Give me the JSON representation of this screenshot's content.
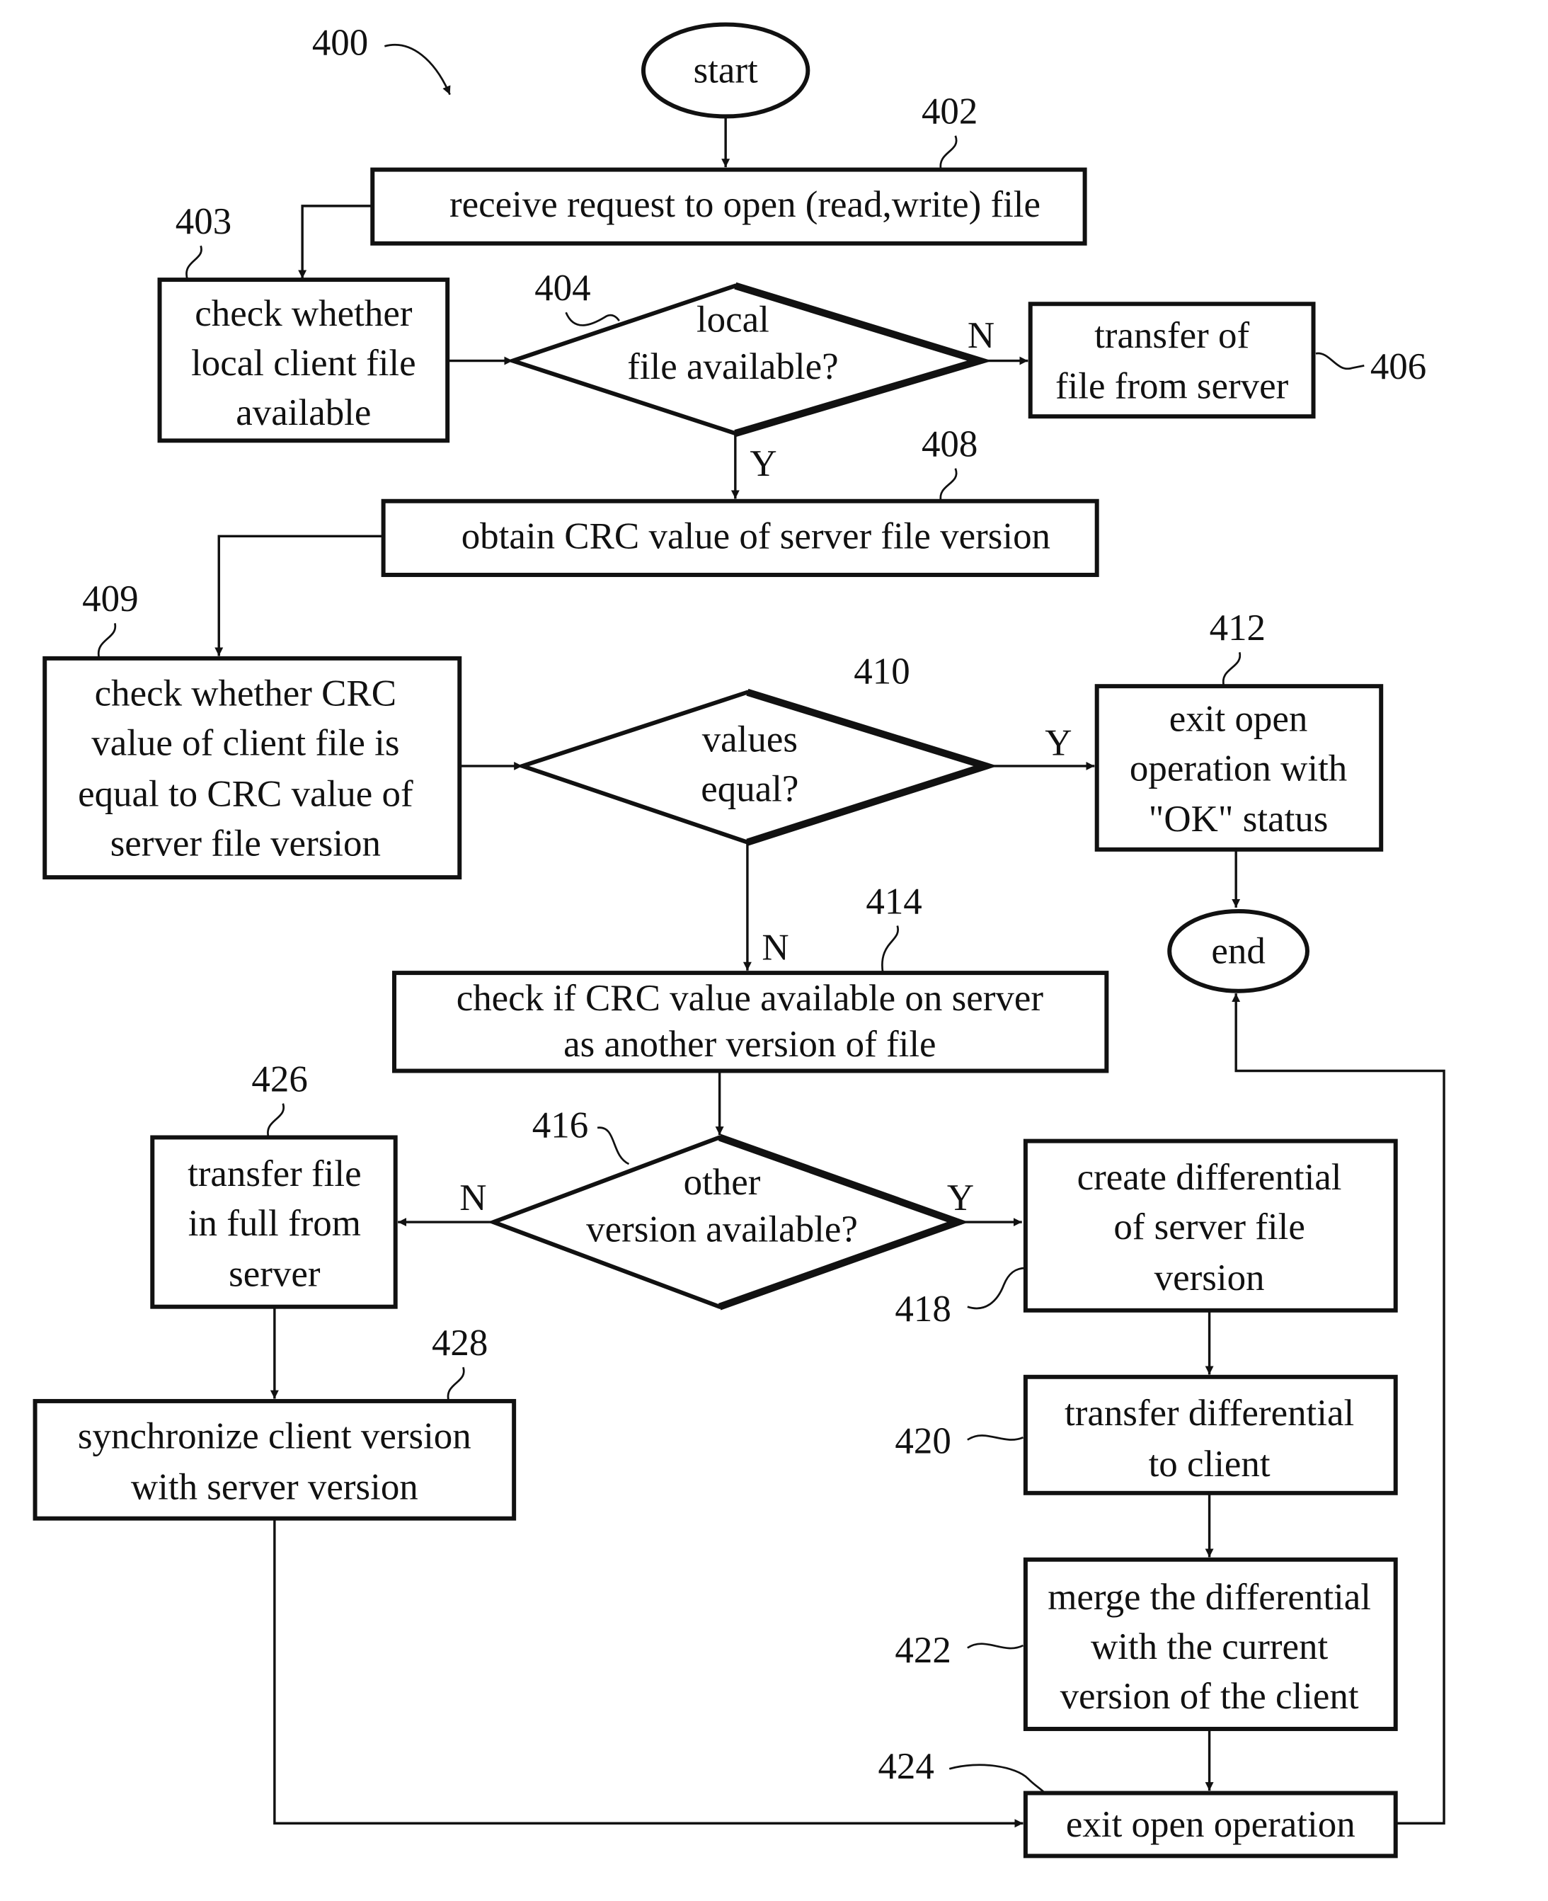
{
  "figure": {
    "ref": "400",
    "start": "start",
    "end": "end",
    "nodes": {
      "n402": {
        "ref": "402",
        "lines": [
          "receive request to open (read,write) file"
        ]
      },
      "n403": {
        "ref": "403",
        "lines": [
          "check whether",
          "local client file",
          "available"
        ]
      },
      "n404": {
        "ref": "404",
        "lines": [
          "local",
          "file available?"
        ]
      },
      "n406": {
        "ref": "406",
        "lines": [
          "transfer of",
          "file from server"
        ]
      },
      "n408": {
        "ref": "408",
        "lines": [
          "obtain CRC value of server file version"
        ]
      },
      "n409": {
        "ref": "409",
        "lines": [
          "check whether CRC",
          "value of client file is",
          "equal to CRC value of",
          "server file version"
        ]
      },
      "n410": {
        "ref": "410",
        "lines": [
          "values",
          "equal?"
        ]
      },
      "n412": {
        "ref": "412",
        "lines": [
          "exit open",
          "operation with",
          "\"OK\" status"
        ]
      },
      "n414": {
        "ref": "414",
        "lines": [
          "check if CRC value available on server",
          "as another version of file"
        ]
      },
      "n416": {
        "ref": "416",
        "lines": [
          "other",
          "version available?"
        ]
      },
      "n418": {
        "ref": "418",
        "lines": [
          "create differential",
          "of server file",
          "version"
        ]
      },
      "n420": {
        "ref": "420",
        "lines": [
          "transfer differential",
          "to client"
        ]
      },
      "n422": {
        "ref": "422",
        "lines": [
          "merge the differential",
          "with the current",
          "version of the client"
        ]
      },
      "n424": {
        "ref": "424",
        "lines": [
          "exit open operation"
        ]
      },
      "n426": {
        "ref": "426",
        "lines": [
          "transfer file",
          "in full from",
          "server"
        ]
      },
      "n428": {
        "ref": "428",
        "lines": [
          "synchronize client version",
          "with server version"
        ]
      }
    },
    "edge_labels": {
      "e404_no": "N",
      "e404_yes": "Y",
      "e410_yes": "Y",
      "e410_no": "N",
      "e416_no": "N",
      "e416_yes": "Y"
    }
  }
}
